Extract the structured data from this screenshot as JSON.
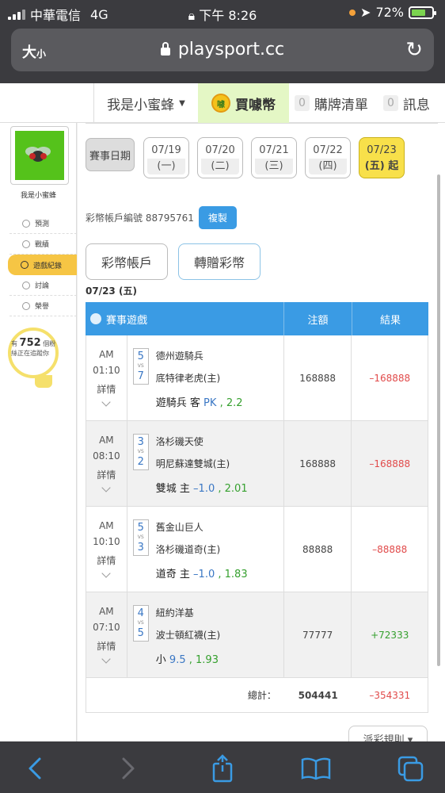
{
  "status_bar": {
    "carrier": "中華電信",
    "network": "4G",
    "time": "下午 8:26",
    "battery": "72%",
    "battery_level": 0.72
  },
  "browser": {
    "text_size_label": "大",
    "text_size_small": "小",
    "url": "playsport.cc"
  },
  "header": {
    "user_menu": "我是小蜜蜂",
    "buy_coins": "買噱幣",
    "coin_logo_text": "噱",
    "cart_count": "0",
    "cart_label": "購牌清單",
    "msg_count": "0",
    "msg_label": "訊息"
  },
  "sidebar": {
    "username": "我是小蜜蜂",
    "items": [
      {
        "label": "預測"
      },
      {
        "label": "戰績"
      },
      {
        "label": "遊戲紀錄"
      },
      {
        "label": "討論"
      },
      {
        "label": "榮譽"
      }
    ],
    "tracker_prefix": "有",
    "tracker_count": "752",
    "tracker_suffix": "個粉",
    "tracker_line2": "絲正在追蹤你"
  },
  "dates": {
    "label": "賽事日期",
    "buttons": [
      {
        "date": "07/19",
        "dow": "(一)"
      },
      {
        "date": "07/20",
        "dow": "(二)"
      },
      {
        "date": "07/21",
        "dow": "(三)"
      },
      {
        "date": "07/22",
        "dow": "(四)"
      },
      {
        "date": "07/23",
        "dow": "(五) 起"
      }
    ]
  },
  "account": {
    "label": "彩幣帳戶編號 88795761",
    "copy": "複製"
  },
  "tabs": {
    "first": "彩幣帳戶",
    "second": "轉贈彩幣"
  },
  "date_heading": "07/23 (五)",
  "table": {
    "headers": {
      "game": "賽事遊戲",
      "bet": "注額",
      "result": "結果"
    },
    "rows": [
      {
        "ampm": "AM",
        "time": "01:10",
        "detail": "詳情",
        "score_a": "5",
        "vs": "VS",
        "score_b": "7",
        "team_a": "德州遊騎兵",
        "team_b": "底特律老虎(主)",
        "pick_team": "遊騎兵 客",
        "pick_line": "PK",
        "pick_odds": ", 2.2",
        "bet": "168888",
        "result": "–168888"
      },
      {
        "ampm": "AM",
        "time": "08:10",
        "detail": "詳情",
        "score_a": "3",
        "vs": "VS",
        "score_b": "2",
        "team_a": "洛杉磯天使",
        "team_b": "明尼蘇達雙城(主)",
        "pick_team": "雙城 主",
        "pick_line": "–1.0",
        "pick_odds": ", 2.01",
        "bet": "168888",
        "result": "–168888"
      },
      {
        "ampm": "AM",
        "time": "10:10",
        "detail": "詳情",
        "score_a": "5",
        "vs": "VS",
        "score_b": "3",
        "team_a": "舊金山巨人",
        "team_b": "洛杉磯道奇(主)",
        "pick_team": "道奇 主",
        "pick_line": "–1.0",
        "pick_odds": ", 1.83",
        "bet": "88888",
        "result": "–88888"
      },
      {
        "ampm": "AM",
        "time": "07:10",
        "detail": "詳情",
        "score_a": "4",
        "vs": "VS",
        "score_b": "5",
        "team_a": "紐約洋基",
        "team_b": "波士頓紅襪(主)",
        "pick_team": "小",
        "pick_line": "9.5",
        "pick_odds": ", 1.93",
        "bet": "77777",
        "result": "+72333"
      }
    ],
    "total_label": "總計：",
    "total_bet": "504441",
    "total_result": "–354331"
  },
  "rules_button": "派彩規則 ▾",
  "colors": {
    "accent": "#3a9be4",
    "selected_date": "#f8e04a",
    "negative": "#e14b4b",
    "positive": "#35a02e"
  }
}
